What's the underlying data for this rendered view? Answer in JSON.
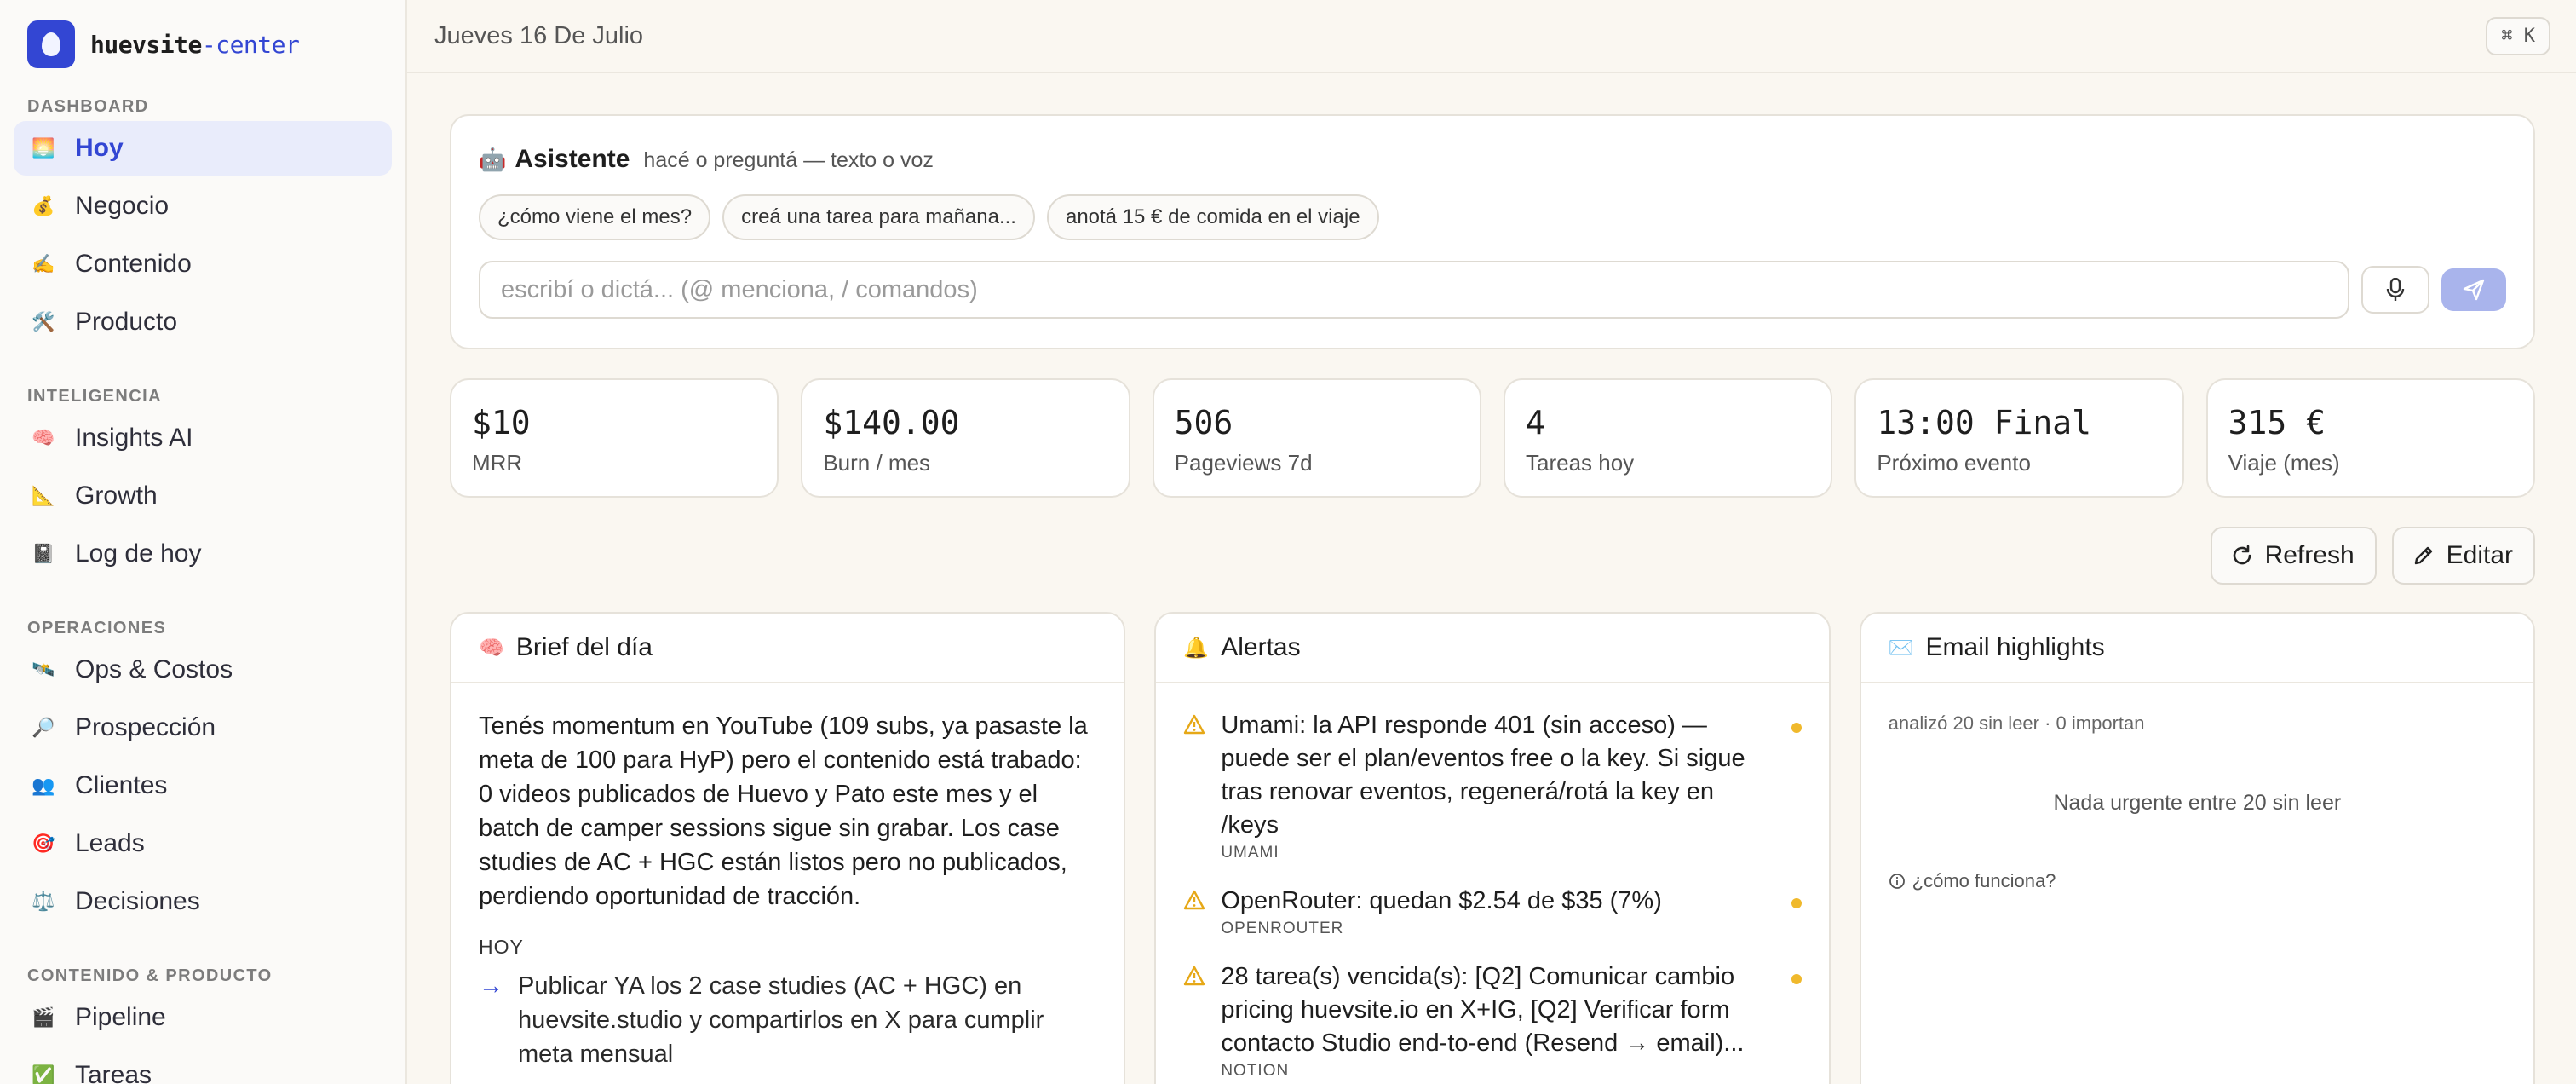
{
  "brand": {
    "name_a": "huevsite",
    "name_b": "-center"
  },
  "sidebar": {
    "sections": [
      {
        "title": "DASHBOARD",
        "items": [
          {
            "icon": "🌅",
            "label": "Hoy",
            "active": true
          },
          {
            "icon": "💰",
            "label": "Negocio"
          },
          {
            "icon": "✍️",
            "label": "Contenido"
          },
          {
            "icon": "🛠️",
            "label": "Producto"
          }
        ]
      },
      {
        "title": "INTELIGENCIA",
        "items": [
          {
            "icon": "🧠",
            "label": "Insights AI"
          },
          {
            "icon": "📐",
            "label": "Growth"
          },
          {
            "icon": "📓",
            "label": "Log de hoy"
          }
        ]
      },
      {
        "title": "OPERACIONES",
        "items": [
          {
            "icon": "🛰️",
            "label": "Ops & Costos"
          },
          {
            "icon": "🔎",
            "label": "Prospección"
          },
          {
            "icon": "👥",
            "label": "Clientes"
          },
          {
            "icon": "🎯",
            "label": "Leads"
          },
          {
            "icon": "⚖️",
            "label": "Decisiones"
          }
        ]
      },
      {
        "title": "CONTENIDO & PRODUCTO",
        "items": [
          {
            "icon": "🎬",
            "label": "Pipeline"
          },
          {
            "icon": "✅",
            "label": "Tareas"
          }
        ]
      }
    ]
  },
  "header": {
    "date": "Jueves 16 De Julio",
    "shortcut": "⌘ K"
  },
  "assistant": {
    "icon": "🤖",
    "title": "Asistente",
    "subtitle": "hacé o preguntá — texto o voz",
    "chips": [
      "¿cómo viene el mes?",
      "creá una tarea para mañana...",
      "anotá 15 € de comida en el viaje"
    ],
    "placeholder": "escribí o dictá... (@ menciona, / comandos)"
  },
  "stats": [
    {
      "value": "$10",
      "label": "MRR"
    },
    {
      "value": "$140.00",
      "label": "Burn / mes"
    },
    {
      "value": "506",
      "label": "Pageviews 7d"
    },
    {
      "value": "4",
      "label": "Tareas hoy"
    },
    {
      "value": "13:00 Final",
      "label": "Próximo evento"
    },
    {
      "value": "315 €",
      "label": "Viaje (mes)"
    }
  ],
  "actions": {
    "refresh": "Refresh",
    "edit": "Editar"
  },
  "brief": {
    "icon": "🧠",
    "title": "Brief del día",
    "text": "Tenés momentum en YouTube (109 subs, ya pasaste la meta de 100 para HyP) pero el contenido está trabado: 0 videos publicados de Huevo y Pato este mes y el batch de camper sessions sigue sin grabar. Los case studies de AC + HGC están listos pero no publicados, perdiendo oportunidad de tracción.",
    "section": "HOY",
    "arrow": "→",
    "item": "Publicar YA los 2 case studies (AC + HGC) en huevsite.studio y compartirlos en X para cumplir meta mensual"
  },
  "alerts": {
    "icon": "🔔",
    "title": "Alertas",
    "items": [
      {
        "text": "Umami: la API responde 401 (sin acceso) — puede ser el plan/eventos free o la key. Si sigue tras renovar eventos, regenerá/rotá la key en /keys",
        "source": "UMAMI"
      },
      {
        "text": "OpenRouter: quedan $2.54 de $35 (7%)",
        "source": "OPENROUTER"
      },
      {
        "text": "28 tarea(s) vencida(s): [Q2] Comunicar cambio pricing huevsite.io en X+IG, [Q2] Verificar form contacto Studio end-to-end (Resend → email)...",
        "source": "NOTION"
      }
    ]
  },
  "email": {
    "icon": "✉️",
    "title": "Email highlights",
    "meta": "analizó 20 sin leer · 0 importan",
    "empty": "Nada urgente entre 20 sin leer",
    "how": "¿cómo funciona?"
  },
  "colors": {
    "accent": "#3346d3",
    "alert": "#f0b92c"
  }
}
